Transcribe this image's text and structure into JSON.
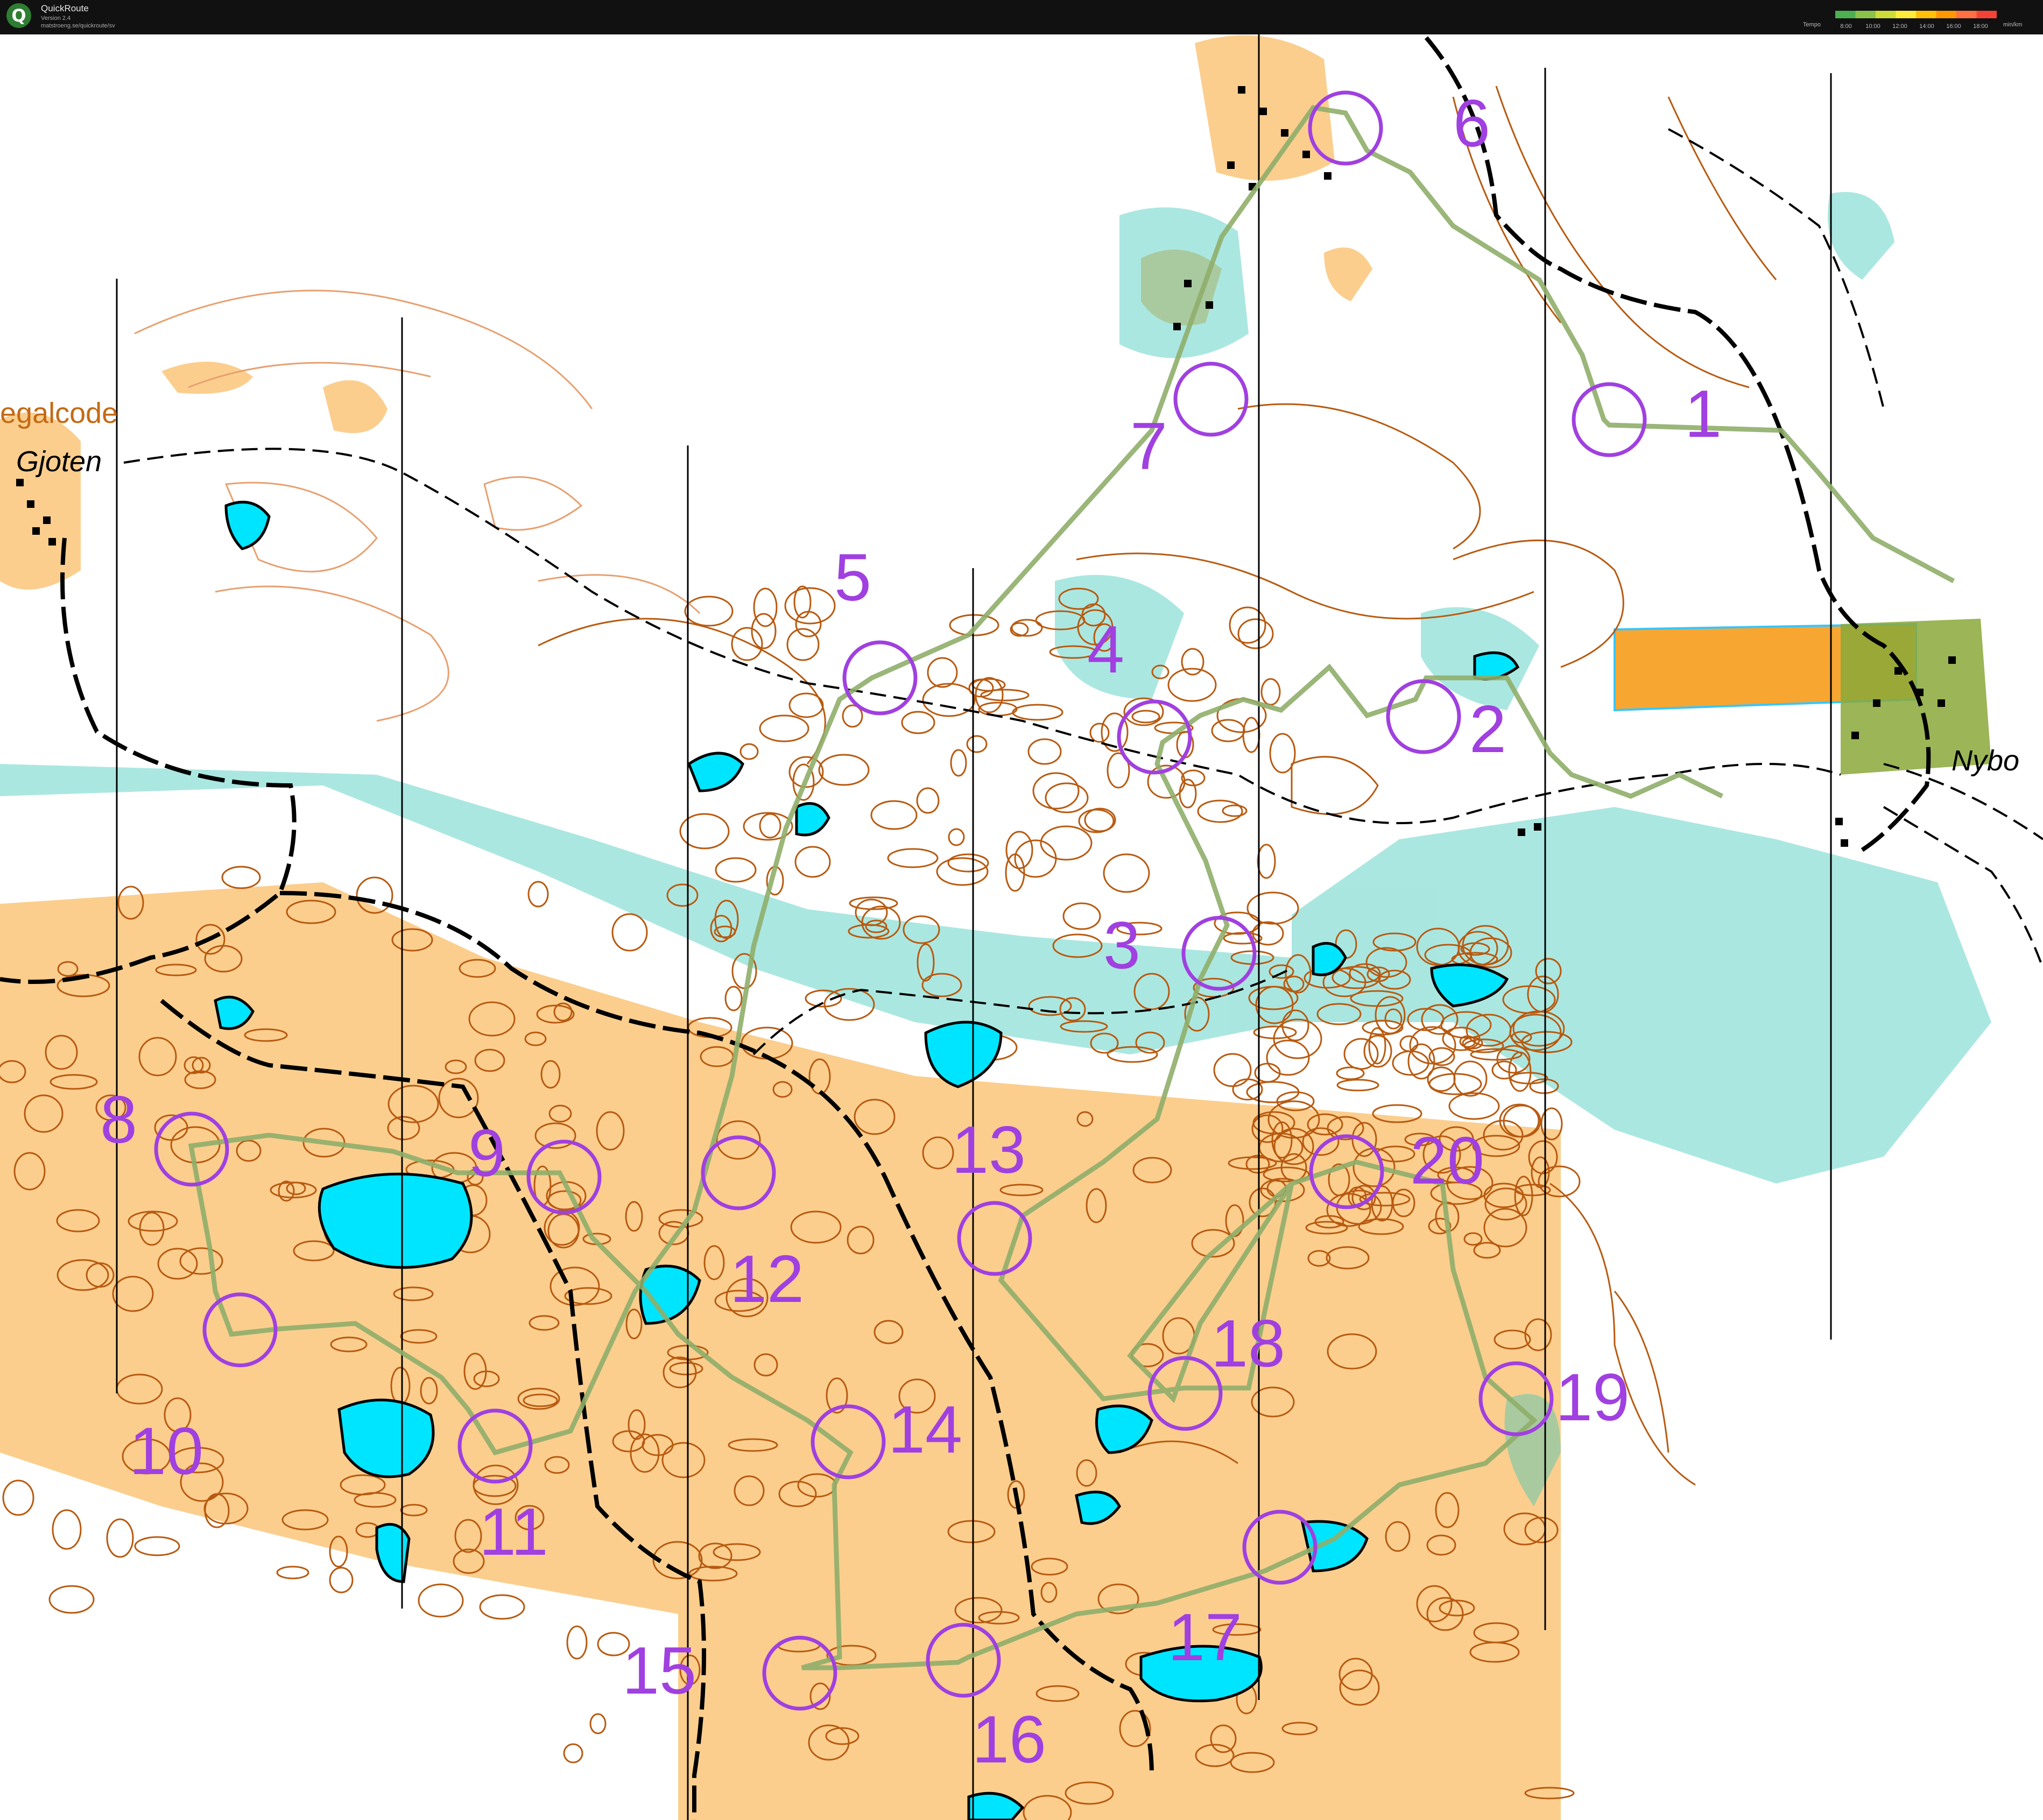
{
  "app": {
    "title": "QuickRoute",
    "version": "Version 2.4",
    "url": "matstroeng.se/quickroute/sv",
    "logo_letter": "Q"
  },
  "tempo_legend": {
    "label": "Tempo",
    "unit": "min/km",
    "ticks": [
      "8:00",
      "10:00",
      "12:00",
      "14:00",
      "16:00",
      "18:00"
    ],
    "colors": [
      "#4caf50",
      "#8bc34a",
      "#cddc39",
      "#ffeb3b",
      "#ffc107",
      "#ff9800",
      "#ff7043",
      "#f44336"
    ]
  },
  "map": {
    "place_names": [
      "egalcode",
      "Gjoten",
      "Nybo"
    ],
    "control_numbers": [
      "1",
      "2",
      "3",
      "4",
      "5",
      "6",
      "7",
      "8",
      "9",
      "10",
      "11",
      "12",
      "13",
      "14",
      "15",
      "16",
      "17",
      "18",
      "19",
      "20"
    ],
    "colors": {
      "course": "#a040e0",
      "route": "#8fae6a",
      "water": "#00e5ff",
      "open_land": "#f7a632",
      "marsh": "#36c6b7",
      "contour": "#b85a10",
      "road": "#000000"
    }
  }
}
